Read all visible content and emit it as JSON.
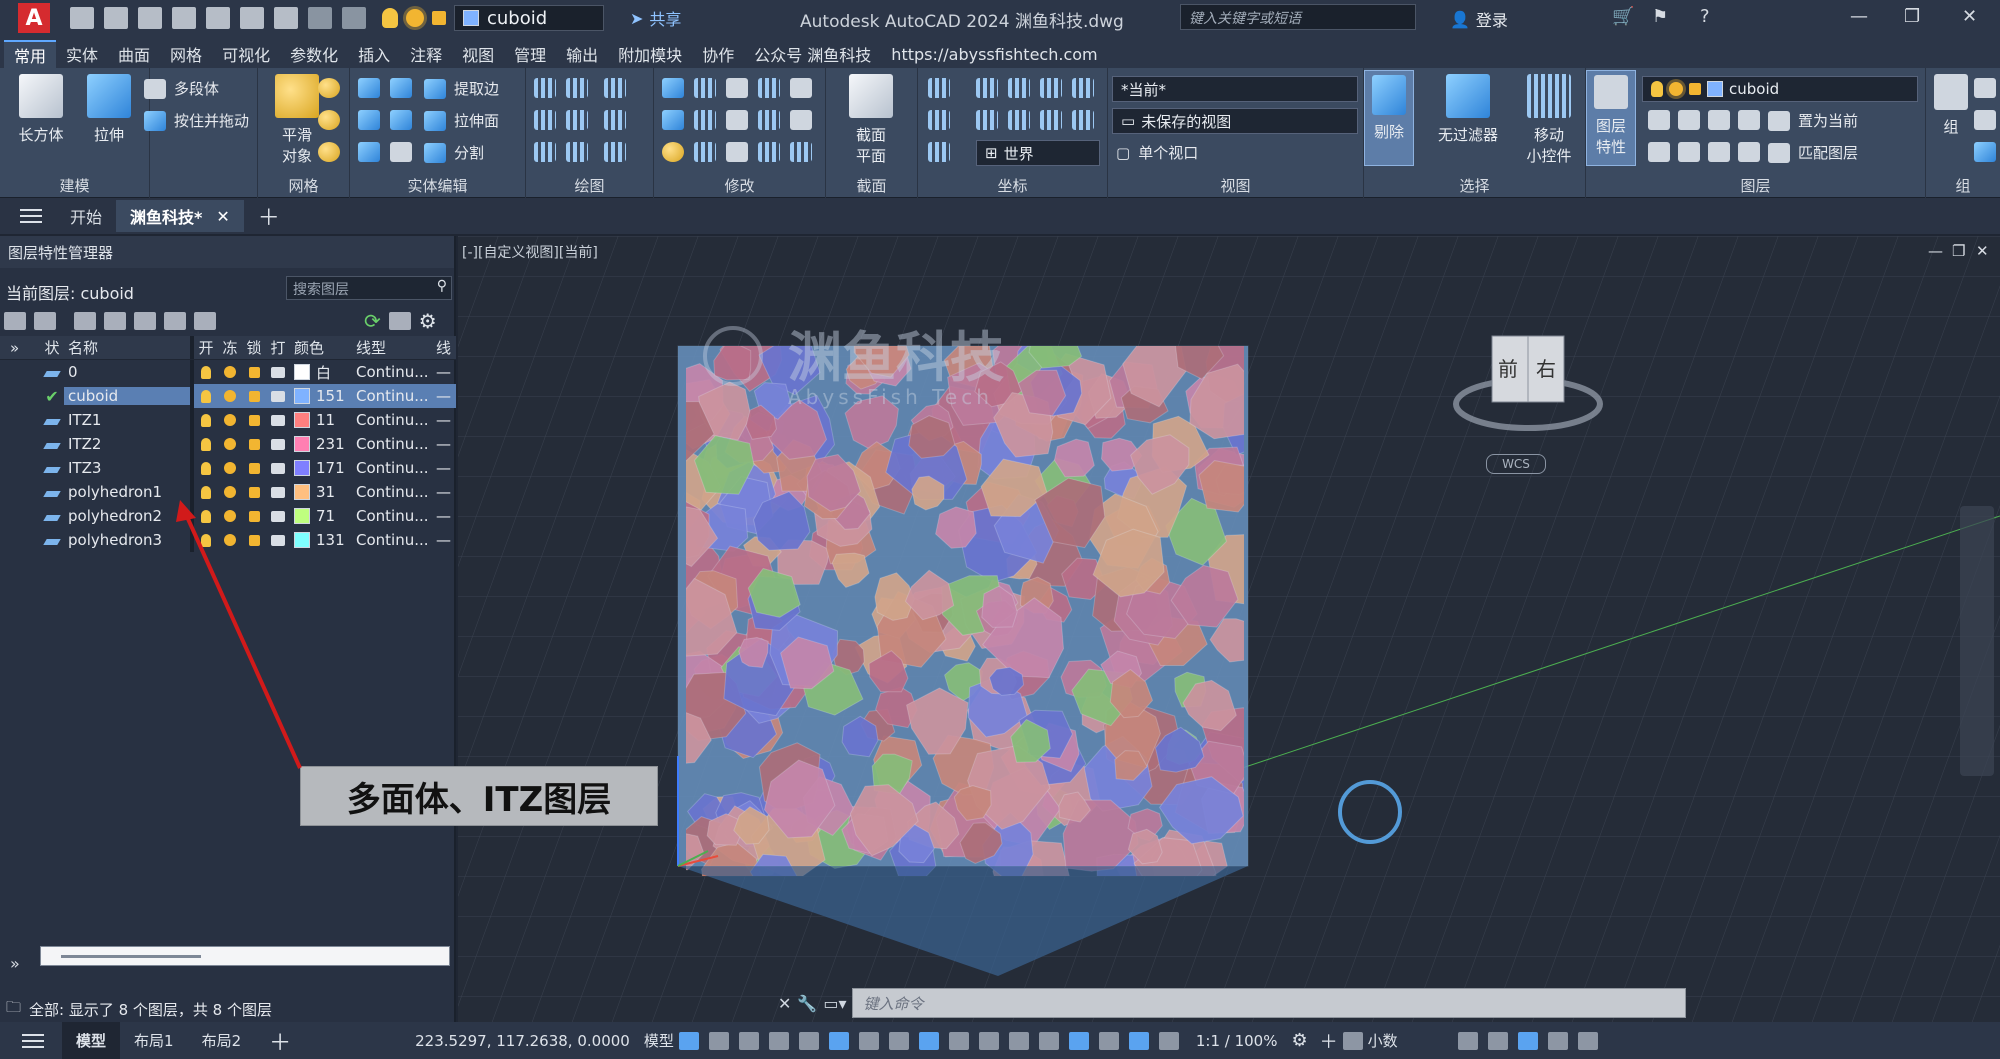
{
  "titlebar": {
    "app_letter": "A",
    "layer_combo": "cuboid",
    "share_label": "共享",
    "title": "Autodesk AutoCAD 2024   渊鱼科技.dwg",
    "search_placeholder": "键入关键字或短语",
    "login_label": "登录"
  },
  "ribbon_tabs": [
    "常用",
    "实体",
    "曲面",
    "网格",
    "可视化",
    "参数化",
    "插入",
    "注释",
    "视图",
    "管理",
    "输出",
    "附加模块",
    "协作",
    "公众号 渊鱼科技",
    "https://abyssfishtech.com"
  ],
  "ribbon": {
    "modeling": {
      "label": "建模",
      "box": "长方体",
      "extrude": "拉伸",
      "polysolid": "多段体",
      "presspull": "按住并拖动"
    },
    "mesh": {
      "label": "网格",
      "smooth1": "平滑",
      "smooth2": "对象"
    },
    "solid_edit": {
      "label": "实体编辑",
      "extract_edges": "提取边",
      "extrude_faces": "拉伸面",
      "separate": "分割"
    },
    "draw": {
      "label": "绘图"
    },
    "modify": {
      "label": "修改"
    },
    "section": {
      "label": "截面",
      "plane1": "截面",
      "plane2": "平面"
    },
    "coords": {
      "label": "坐标",
      "world": "世界"
    },
    "view": {
      "label": "视图",
      "current": "*当前*",
      "unsaved": "未保存的视图",
      "single_vp": "单个视口"
    },
    "selection": {
      "label": "选择",
      "culling": "剔除",
      "no_filter": "无过滤器",
      "gizmo1": "移动",
      "gizmo2": "小控件"
    },
    "layers": {
      "label": "图层",
      "props1": "图层",
      "props2": "特性",
      "combo": "cuboid",
      "set_current": "置为当前",
      "match": "匹配图层"
    },
    "group": {
      "label": "组",
      "group_btn": "组"
    }
  },
  "doctabs": {
    "start": "开始",
    "active": "渊鱼科技*"
  },
  "layer_panel": {
    "title": "图层特性管理器",
    "current_layer": "当前图层: cuboid",
    "search_placeholder": "搜索图层",
    "headers": {
      "status": "状",
      "name": "名称",
      "on": "开",
      "freeze": "冻",
      "lock": "锁",
      "plot": "打",
      "color": "颜色",
      "linetype": "线型",
      "lw": "线"
    },
    "rows": [
      {
        "name": "0",
        "color": "白",
        "swatch": "#ffffff",
        "linetype": "Continu...",
        "selected": false
      },
      {
        "name": "cuboid",
        "color": "151",
        "swatch": "#7fb2ff",
        "linetype": "Continu...",
        "selected": true
      },
      {
        "name": "ITZ1",
        "color": "11",
        "swatch": "#ff7f7f",
        "linetype": "Continu...",
        "selected": false
      },
      {
        "name": "ITZ2",
        "color": "231",
        "swatch": "#ff7fb2",
        "linetype": "Continu...",
        "selected": false
      },
      {
        "name": "ITZ3",
        "color": "171",
        "swatch": "#7f7fff",
        "linetype": "Continu...",
        "selected": false
      },
      {
        "name": "polyhedron1",
        "color": "31",
        "swatch": "#ffbf7f",
        "linetype": "Continu...",
        "selected": false
      },
      {
        "name": "polyhedron2",
        "color": "71",
        "swatch": "#bfff7f",
        "linetype": "Continu...",
        "selected": false
      },
      {
        "name": "polyhedron3",
        "color": "131",
        "swatch": "#7fffff",
        "linetype": "Continu...",
        "selected": false
      }
    ],
    "footer": "全部: 显示了 8 个图层，共 8 个图层"
  },
  "viewport": {
    "label": "[-][自定义视图][当前]",
    "watermark_cn": "渊鱼科技",
    "watermark_en": "AbyssFish Tech",
    "cube_front": "前",
    "cube_right": "右",
    "wcs": "WCS",
    "annotation": "多面体、ITZ图层"
  },
  "cmdline": {
    "placeholder": "键入命令"
  },
  "statusbar": {
    "model_tab": "模型",
    "layout1": "布局1",
    "layout2": "布局2",
    "coords": "223.5297, 117.2638, 0.0000",
    "model_space": "模型",
    "scale": "1:1 / 100%",
    "units": "小数"
  }
}
